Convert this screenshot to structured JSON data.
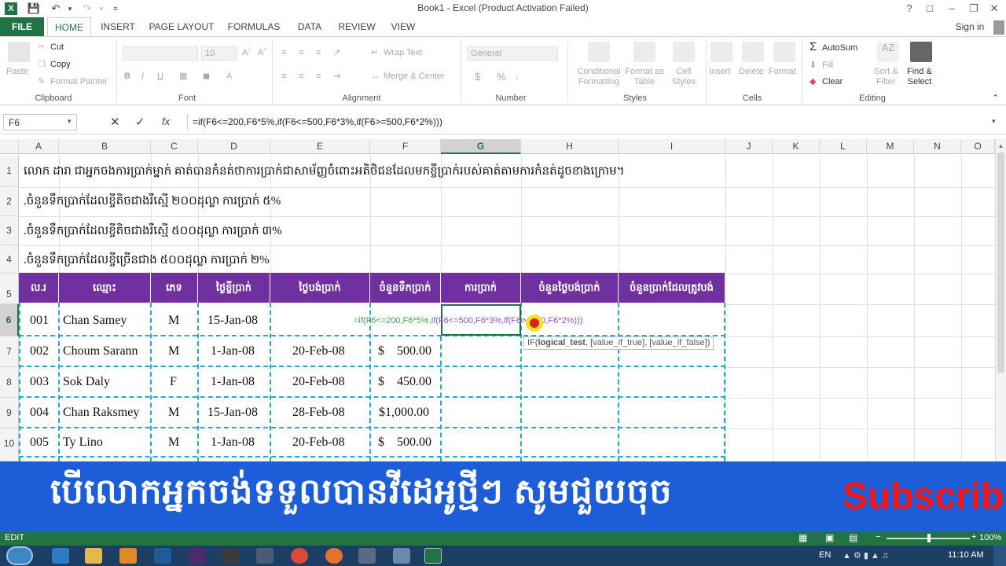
{
  "window": {
    "title": "Book1 - Excel (Product Activation Failed)"
  },
  "tabs": [
    "FILE",
    "HOME",
    "INSERT",
    "PAGE LAYOUT",
    "FORMULAS",
    "DATA",
    "REVIEW",
    "VIEW"
  ],
  "signin": "Sign in",
  "ribbon": {
    "clipboard": {
      "paste": "Paste",
      "cut": "Cut",
      "copy": "Copy",
      "format_painter": "Format Painter",
      "label": "Clipboard"
    },
    "font": {
      "size": "10",
      "label": "Font"
    },
    "alignment": {
      "wrap": "Wrap Text",
      "merge": "Merge & Center",
      "label": "Alignment"
    },
    "number": {
      "format": "General",
      "currency": "$",
      "percent": "%",
      "label": "Number"
    },
    "styles": {
      "conditional": "Conditional",
      "conditional2": "Formatting",
      "format_as": "Format as",
      "format_as2": "Table",
      "cell": "Cell",
      "cell2": "Styles",
      "label": "Styles"
    },
    "cells": {
      "insert": "Insert",
      "delete": "Delete",
      "format": "Format",
      "label": "Cells"
    },
    "editing": {
      "autosum": "AutoSum",
      "fill": "Fill",
      "clear": "Clear",
      "sort": "Sort &",
      "sort2": "Filter",
      "find": "Find &",
      "find2": "Select",
      "label": "Editing"
    }
  },
  "formula_bar": {
    "name_box": "F6",
    "fx": "fx",
    "formula": "=if(F6<=200,F6*5%,if(F6<=500,F6*3%,if(F6>=500,F6*2%)))"
  },
  "columns": [
    "A",
    "B",
    "C",
    "D",
    "E",
    "F",
    "G",
    "H",
    "I",
    "J",
    "K",
    "L",
    "M",
    "N",
    "O"
  ],
  "rows": [
    "1",
    "2",
    "3",
    "4",
    "5",
    "6",
    "7",
    "8",
    "9",
    "10"
  ],
  "notes": [
    "លោក ដារា ជាអ្នកចងការប្រាក់ម្នាក់ គាត់បានកំនត់ថាការប្រាក់ជាសាម័ញ្ញចំពោះអតិថិជនដែលមកខ្ចីប្រាក់របស់គាត់តាមការកំនត់ដូចខាងក្រោម។",
    ".ចំនួនទឹកប្រាក់ដែលខ្ចីតិចជាងរឺស្មើ ២០០ដុល្លា ការប្រាក់ ៥%",
    ".ចំនួនទឹកប្រាក់ដែលខ្ចីតិចជាងរឺស្មើ ៥០០ដុល្លា ការប្រាក់ ៣%",
    ".ចំនួនទឹកប្រាក់ដែលខ្ចីច្រើនជាង ៥០០ដុល្លា ការប្រាក់ ២%"
  ],
  "table_headers": [
    "ល.រ",
    "ឈ្មោះ",
    "ភេទ",
    "ថ្ងៃខ្ចីប្រាក់",
    "ថ្ងៃបង់ប្រាក់",
    "ចំនួនទឹកប្រាក់",
    "ការប្រាក់",
    "ចំនួនថ្ងៃបង់ប្រាក់",
    "ចំនួនប្រាក់ដែលត្រូវបង់"
  ],
  "table_rows": [
    {
      "no": "001",
      "name": "Chan Samey",
      "sex": "M",
      "borrow": "15-Jan-08",
      "pay": "",
      "cur": "",
      "amount": ""
    },
    {
      "no": "002",
      "name": "Choum Sarann",
      "sex": "M",
      "borrow": "1-Jan-08",
      "pay": "20-Feb-08",
      "cur": "$",
      "amount": "500.00"
    },
    {
      "no": "003",
      "name": "Sok Daly",
      "sex": "F",
      "borrow": "1-Jan-08",
      "pay": "20-Feb-08",
      "cur": "$",
      "amount": "450.00"
    },
    {
      "no": "004",
      "name": "Chan Raksmey",
      "sex": "M",
      "borrow": "15-Jan-08",
      "pay": "28-Feb-08",
      "cur": "",
      "amount": "$1,000.00"
    },
    {
      "no": "005",
      "name": "Ty Lino",
      "sex": "M",
      "borrow": "1-Jan-08",
      "pay": "20-Feb-08",
      "cur": "$",
      "amount": "500.00"
    }
  ],
  "in_cell_formula": {
    "p1": "=if(F6<=200,F6*5%,",
    "p2": "if(F6<=500,F6*3%,",
    "p3": "if(F6>=500,F6*2%)))"
  },
  "tooltip": {
    "fn": "IF(",
    "arg1": "logical_test",
    "rest": ", [value_if_true], [value_if_false])"
  },
  "banner": {
    "text": "បើលោកអ្នកចង់ទទួលបានវីដេអូថ្មីៗ សូមជួយចុច",
    "subscribe": "Subscrib"
  },
  "status": {
    "mode": "EDIT",
    "zoom": "100%"
  },
  "taskbar": {
    "lang": "EN",
    "time": "11:10 AM"
  },
  "colors": {
    "excel_green": "#217346",
    "header_purple": "#7030a0",
    "banner_blue": "#1d5ed8",
    "dashes": "#28a9c8"
  }
}
